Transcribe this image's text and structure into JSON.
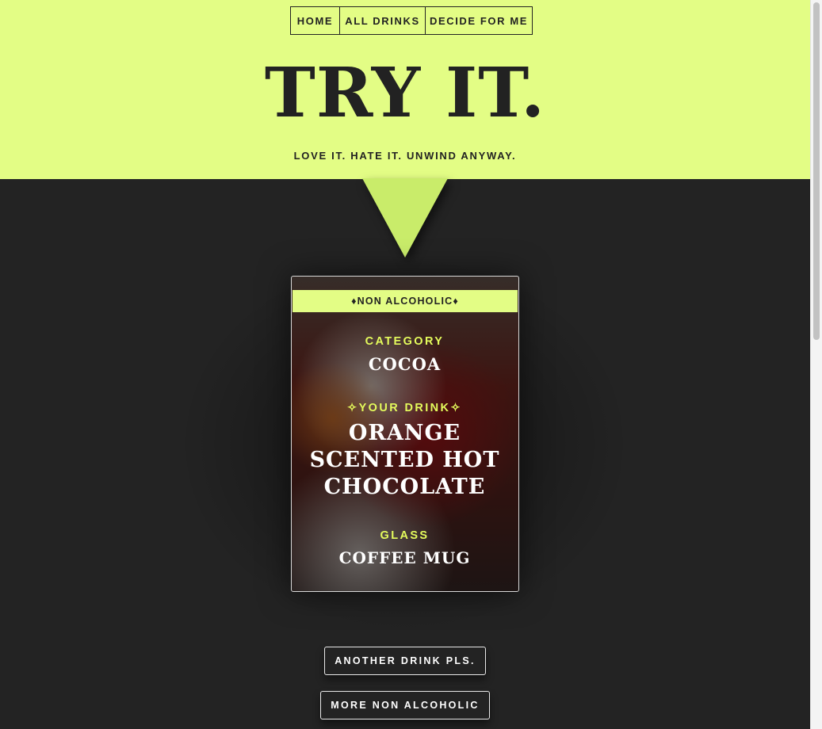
{
  "nav": {
    "items": [
      "HOME",
      "ALL DRINKS",
      "DECIDE FOR ME"
    ]
  },
  "hero": {
    "title": "TRY IT.",
    "tagline": "LOVE IT. HATE IT. UNWIND ANYWAY."
  },
  "card": {
    "badge": "♦NON ALCOHOLIC♦",
    "category_label": "CATEGORY",
    "category_value": "COCOA",
    "drink_label": "✧YOUR DRINK✧",
    "drink_value": "ORANGE SCENTED HOT CHOCOLATE",
    "glass_label": "GLASS",
    "glass_value": "COFFEE MUG"
  },
  "buttons": {
    "another": "ANOTHER DRINK PLS.",
    "more": "MORE NON ALCOHOLIC"
  },
  "colors": {
    "accent": "#e3fd85",
    "background": "#232323",
    "label": "#e4fb5c"
  }
}
